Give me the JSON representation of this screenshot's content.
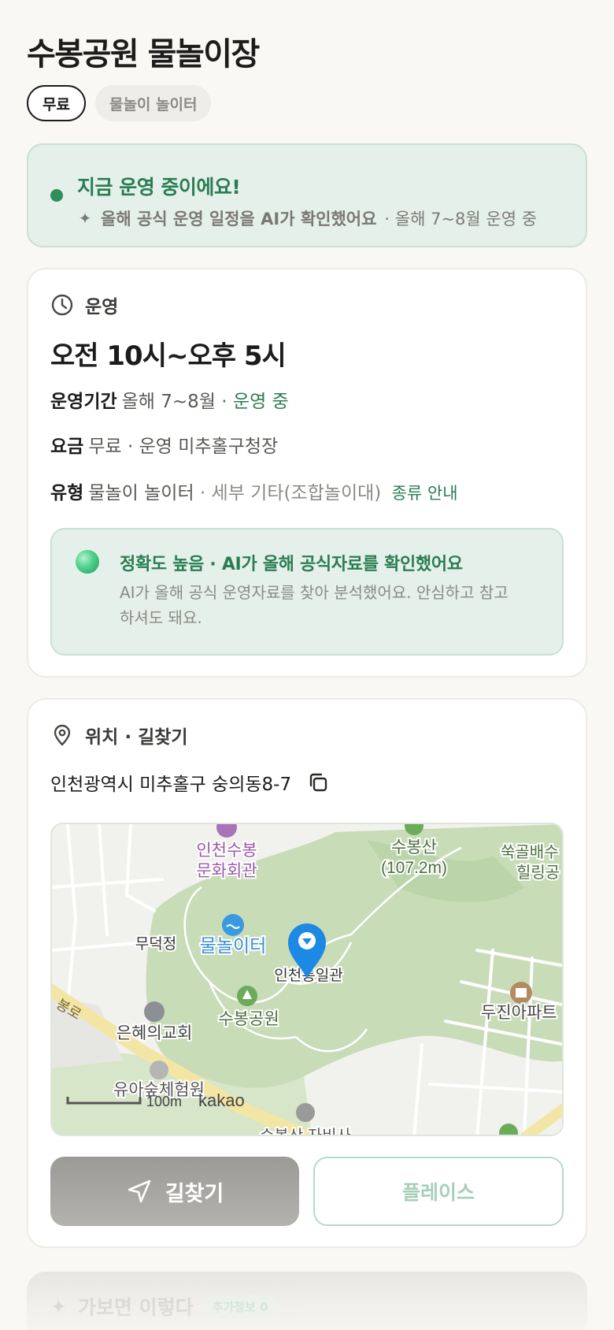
{
  "header": {
    "title": "수봉공원 물놀이장",
    "chips": [
      "무료",
      "물놀이 놀이터"
    ]
  },
  "status": {
    "title": "지금 운영 중이에요!",
    "sub_strong": "올해 공식 운영 일정을 AI가 확인했어요",
    "sub_rest": "· 올해 7~8월 운영 중",
    "dot_color": "#2f8f5b"
  },
  "operation": {
    "section_label": "운영",
    "hours": "오전 10시~오후 5시",
    "period": {
      "key": "운영기간",
      "value": "올해 7~8월",
      "status": "· 운영 중"
    },
    "fee": {
      "key": "요금",
      "value": "무료 · 운영 미추홀구청장"
    },
    "type": {
      "key": "유형",
      "value": "물놀이 놀이터",
      "detail": "· 세부 기타(조합놀이대)",
      "link": "종류 안내"
    },
    "accuracy": {
      "title": "정확도 높음 · AI가 올해 공식자료를 확인했어요",
      "desc": "AI가 올해 공식 운영자료를 찾아 분석했어요. 안심하고 참고하셔도 돼요."
    }
  },
  "location": {
    "section_label": "위치 · 길찾기",
    "address": "인천광역시 미추홀구 숭의동8-7",
    "map": {
      "labels": {
        "culture_center_1": "인천수봉",
        "culture_center_2": "문화회관",
        "mountain": "수봉산",
        "mountain_height": "(107.2m)",
        "healing_1": "쑥골배수",
        "healing_2": "힐링공",
        "pavilion": "무덕정",
        "waterplay": "물놀이터",
        "unification": "인천통일관",
        "road": "봉로",
        "church": "은혜의교회",
        "park": "수봉공원",
        "apartment": "두진아파트",
        "forest": "유아숲체험원",
        "temple": "수봉산 자비사",
        "scale": "100m",
        "brand": "kakao"
      }
    },
    "buttons": {
      "navigate": "길찾기",
      "place": "플레이스"
    }
  },
  "peek": {
    "title": "가보면 이렇다",
    "badge": "추가정보 0"
  },
  "colors": {
    "accent_green": "#2a7d52",
    "map_pin": "#1e88e5",
    "map_park": "#c8dcb8"
  }
}
